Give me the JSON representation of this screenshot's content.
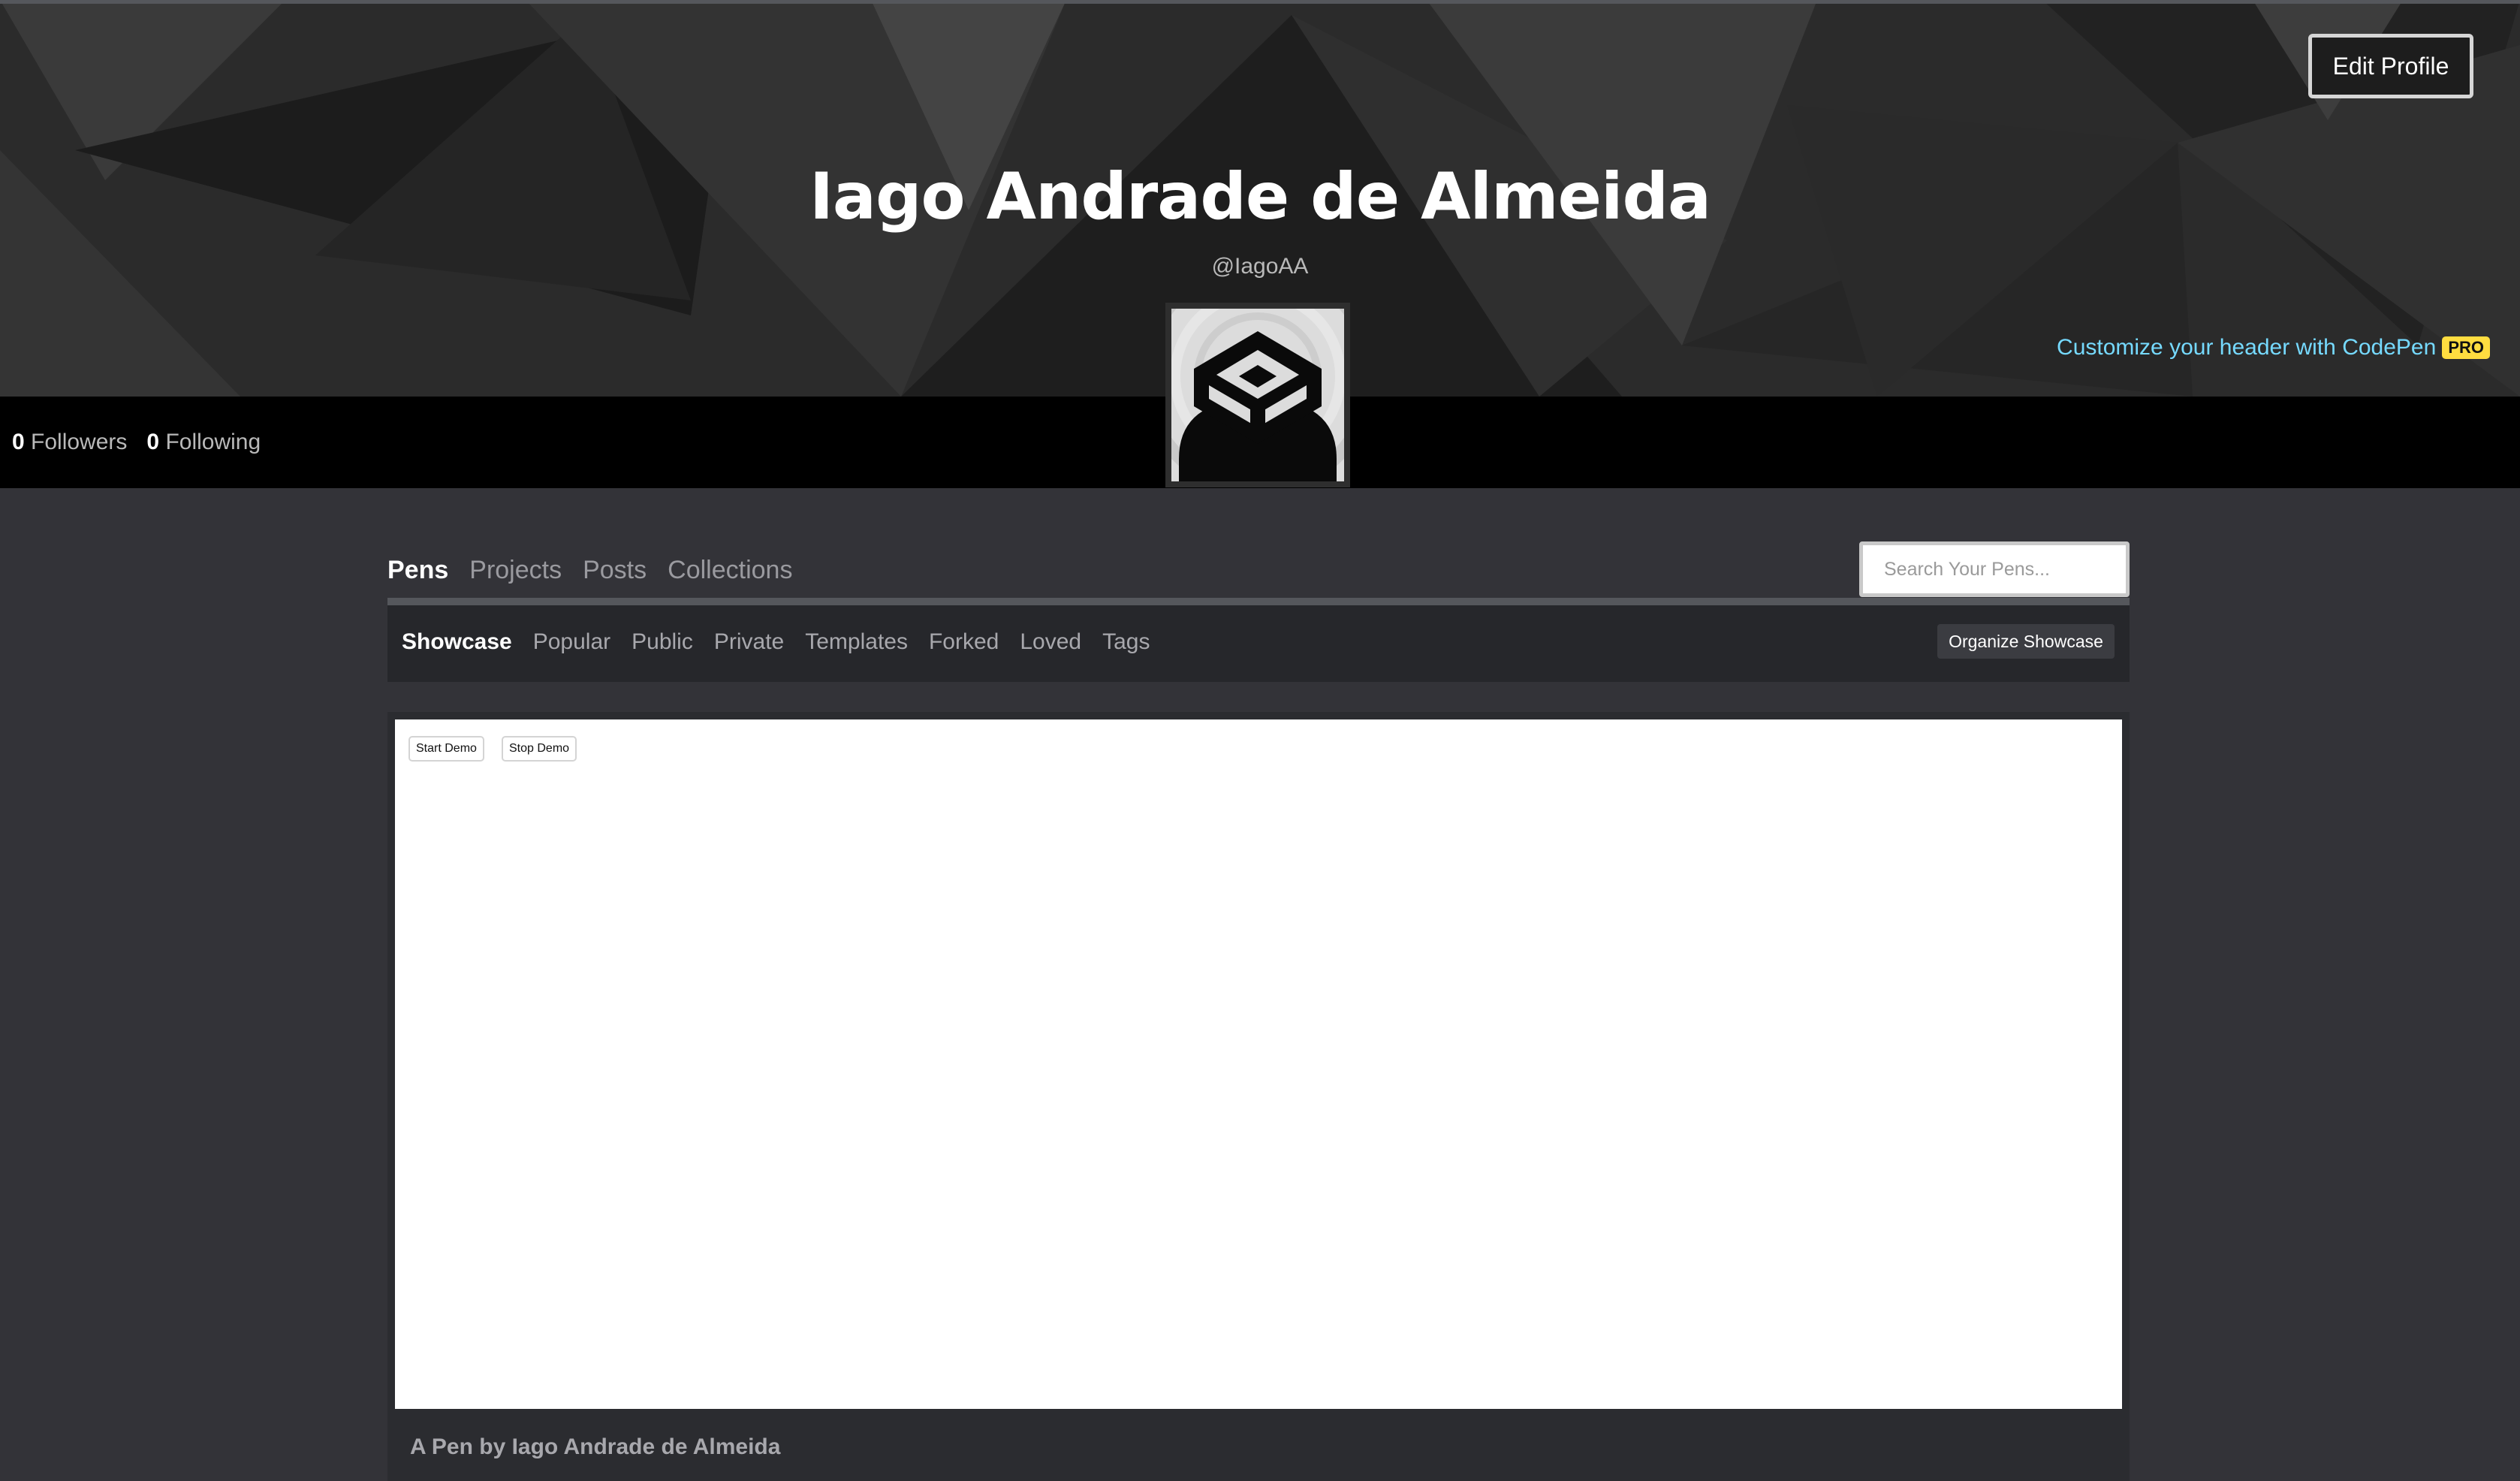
{
  "header": {
    "edit_profile_label": "Edit Profile",
    "name": "Iago Andrade de Almeida",
    "handle": "@IagoAA",
    "customize_text": "Customize your header with CodePen",
    "pro_badge": "PRO",
    "colors": {
      "customize_link": "#76daff",
      "pro_badge": "#ffdd40"
    }
  },
  "stats": {
    "followers_count": "0",
    "followers_label": "Followers",
    "following_count": "0",
    "following_label": "Following"
  },
  "main_tabs": [
    {
      "label": "Pens",
      "active": true
    },
    {
      "label": "Projects",
      "active": false
    },
    {
      "label": "Posts",
      "active": false
    },
    {
      "label": "Collections",
      "active": false
    }
  ],
  "search": {
    "placeholder": "Search Your Pens...",
    "value": ""
  },
  "sub_tabs": [
    {
      "label": "Showcase",
      "active": true
    },
    {
      "label": "Popular",
      "active": false
    },
    {
      "label": "Public",
      "active": false
    },
    {
      "label": "Private",
      "active": false
    },
    {
      "label": "Templates",
      "active": false
    },
    {
      "label": "Forked",
      "active": false
    },
    {
      "label": "Loved",
      "active": false
    },
    {
      "label": "Tags",
      "active": false
    }
  ],
  "organize_label": "Organize Showcase",
  "pen": {
    "start_demo_label": "Start Demo",
    "stop_demo_label": "Stop Demo",
    "caption": "A Pen by Iago Andrade de Almeida"
  }
}
